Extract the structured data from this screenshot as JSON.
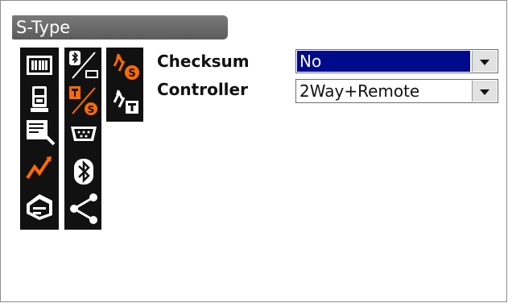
{
  "title": "S-Type",
  "fields": [
    {
      "label": "Checksum",
      "value": "No",
      "selected": true
    },
    {
      "label": "Controller",
      "value": "2Way+Remote",
      "selected": false
    }
  ],
  "icons": {
    "col1": [
      "observation-mode-icon",
      "instrument-icon",
      "document-edit-icon",
      "graph-line-icon",
      "toolbox-icon"
    ],
    "col2": [
      "bluetooth-serial-icon",
      "tablet-serial-icon",
      "serial-port-icon",
      "bluetooth-icon",
      "share-icon"
    ],
    "col3": [
      "sync-s-icon",
      "sync-t-icon"
    ]
  },
  "colors": {
    "accent": "#ff6a00",
    "selection": "#000b8c",
    "title_bg": "#636363"
  }
}
